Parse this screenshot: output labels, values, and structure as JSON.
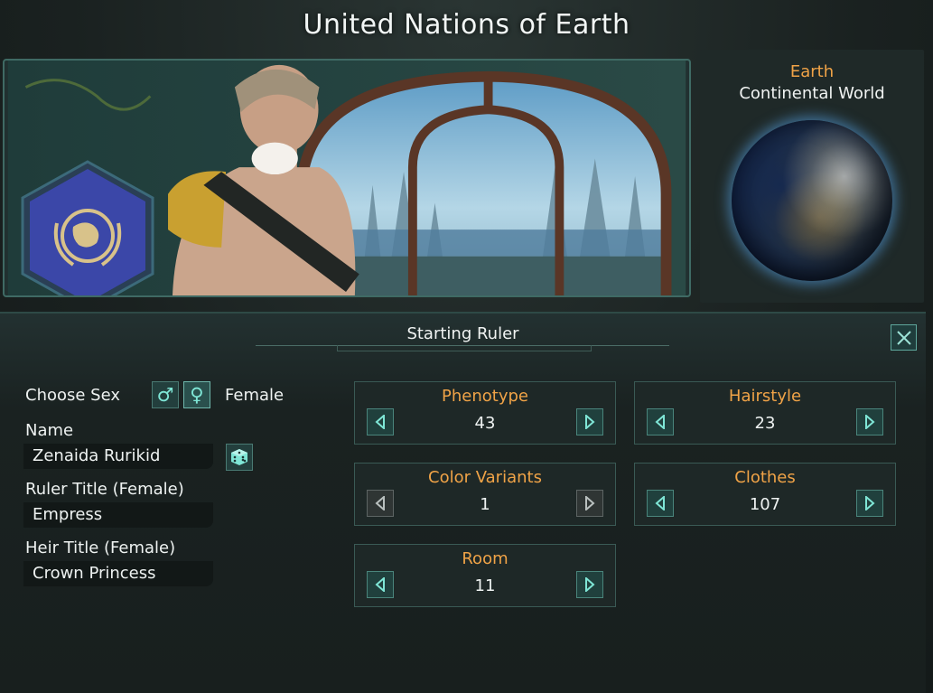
{
  "header": {
    "title": "United Nations of Earth"
  },
  "planet": {
    "name": "Earth",
    "type": "Continental World"
  },
  "ruler_panel": {
    "title": "Starting Ruler",
    "choose_sex_label": "Choose Sex",
    "selected_sex": "Female",
    "name_label": "Name",
    "name_value": "Zenaida Rurikid",
    "ruler_title_label": "Ruler Title (Female)",
    "ruler_title_value": "Empress",
    "heir_title_label": "Heir Title (Female)",
    "heir_title_value": "Crown Princess"
  },
  "selectors": {
    "phenotype": {
      "label": "Phenotype",
      "value": "43"
    },
    "hairstyle": {
      "label": "Hairstyle",
      "value": "23"
    },
    "color_variants": {
      "label": "Color Variants",
      "value": "1"
    },
    "clothes": {
      "label": "Clothes",
      "value": "107"
    },
    "room": {
      "label": "Room",
      "value": "11"
    }
  },
  "colors": {
    "accent_orange": "#f0a347",
    "teal_icon": "#7fe6d6",
    "emblem_blue": "#3b47a8"
  },
  "icons": [
    "male-icon",
    "female-icon",
    "dice-icon",
    "close-icon",
    "arrow-left-icon",
    "arrow-right-icon",
    "un-emblem-icon"
  ]
}
